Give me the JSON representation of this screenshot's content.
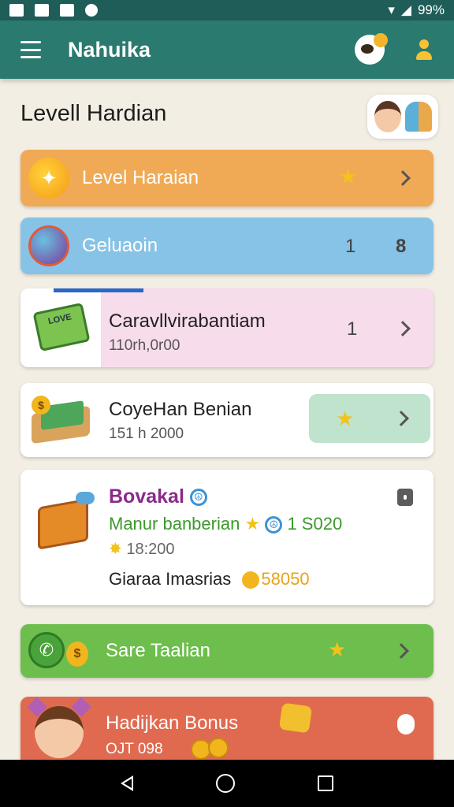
{
  "status_bar": {
    "battery": "99%"
  },
  "app_bar": {
    "title": "Nahuika"
  },
  "page": {
    "title": "Levell Hardian"
  },
  "rows": [
    {
      "title": "Level Haraian",
      "trailing_icon": "star-icon",
      "color": "#f0aa55"
    },
    {
      "title": "Geluaoin",
      "count": "1",
      "trailing": "8",
      "color": "#87c3e6"
    },
    {
      "title": "Caravllvirabantiam",
      "subtitle": "110rh,0r00",
      "count": "1",
      "color": "#f7dcec"
    },
    {
      "title": "CoyeHan Benian",
      "subtitle": "151 h 2000",
      "color": "#ffffff"
    },
    {
      "title": "Bovakal",
      "line2": "Manur banberian",
      "line2_value": "1 S020",
      "line3": "18:200",
      "line4": "Giaraa Imasrias",
      "line4_value": "58050",
      "color": "#ffffff"
    },
    {
      "title": "Sare Taalian",
      "trailing_icon": "star-icon",
      "color": "#6dbe4c"
    },
    {
      "title": "Hadijkan Bonus",
      "subtitle": "OJT 098",
      "color": "#e06a50"
    }
  ],
  "colors": {
    "app_bar": "#2a7a6f",
    "status_bar": "#1f5e58",
    "background": "#f3eee4",
    "star": "#f4c21c"
  }
}
